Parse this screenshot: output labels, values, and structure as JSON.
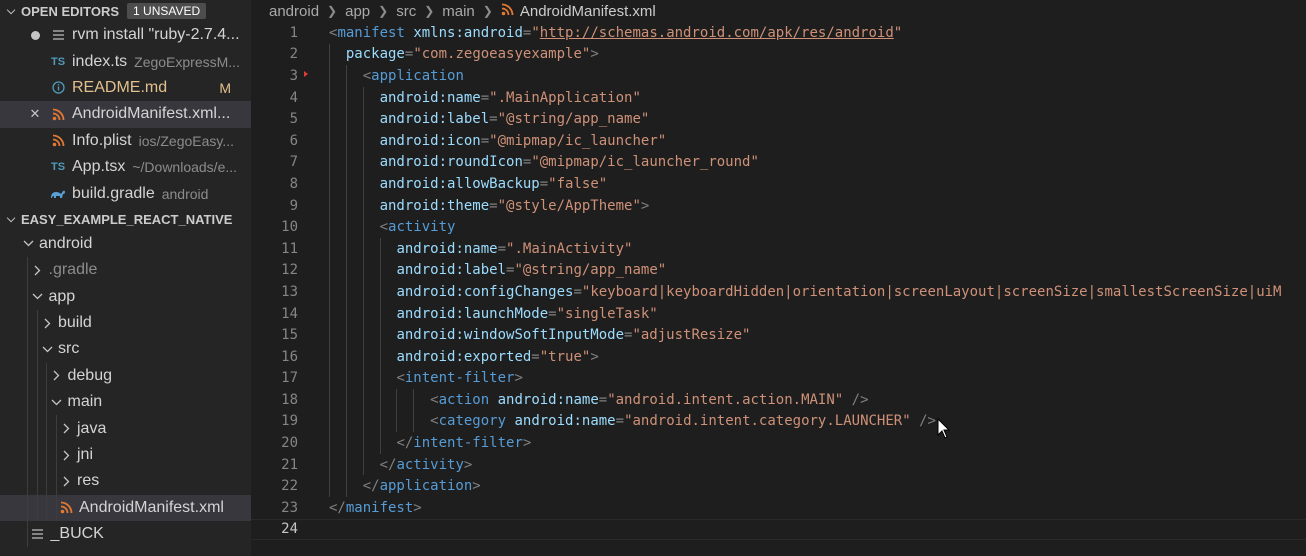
{
  "sidebar": {
    "open_editors": {
      "title": "OPEN EDITORS",
      "badge": "1 UNSAVED",
      "items": [
        {
          "lead": "dot",
          "icon": "terminal-icon",
          "name": "rvm install \"ruby-2.7.4...",
          "desc": "",
          "mark": ""
        },
        {
          "lead": "",
          "icon": "typescript-icon",
          "name": "index.ts",
          "desc": "ZegoExpressM...",
          "mark": ""
        },
        {
          "lead": "",
          "icon": "info-icon",
          "name": "README.md",
          "desc": "",
          "mark": "M"
        },
        {
          "lead": "close",
          "icon": "rss-icon",
          "name": "AndroidManifest.xml...",
          "desc": "",
          "mark": ""
        },
        {
          "lead": "",
          "icon": "rss-icon",
          "name": "Info.plist",
          "desc": "ios/ZegoEasy...",
          "mark": ""
        },
        {
          "lead": "",
          "icon": "typescript-icon",
          "name": "App.tsx",
          "desc": "~/Downloads/e...",
          "mark": ""
        },
        {
          "lead": "",
          "icon": "gradle-icon",
          "name": "build.gradle",
          "desc": "android",
          "mark": ""
        }
      ]
    },
    "project": {
      "title": "EASY_EXAMPLE_REACT_NATIVE",
      "tree": [
        {
          "label": "android",
          "depth": 0,
          "kind": "folder-open"
        },
        {
          "label": ".gradle",
          "depth": 1,
          "kind": "folder-closed"
        },
        {
          "label": "app",
          "depth": 1,
          "kind": "folder-open"
        },
        {
          "label": "build",
          "depth": 2,
          "kind": "folder-closed"
        },
        {
          "label": "src",
          "depth": 2,
          "kind": "folder-open"
        },
        {
          "label": "debug",
          "depth": 3,
          "kind": "folder-closed"
        },
        {
          "label": "main",
          "depth": 3,
          "kind": "folder-open"
        },
        {
          "label": "java",
          "depth": 4,
          "kind": "folder-closed"
        },
        {
          "label": "jni",
          "depth": 4,
          "kind": "folder-closed"
        },
        {
          "label": "res",
          "depth": 4,
          "kind": "folder-closed"
        },
        {
          "label": "AndroidManifest.xml",
          "depth": 4,
          "kind": "file-rss"
        },
        {
          "label": "_BUCK",
          "depth": 1,
          "kind": "file-lines"
        }
      ]
    }
  },
  "editor": {
    "breadcrumb": [
      "android",
      "app",
      "src",
      "main"
    ],
    "file": "AndroidManifest.xml",
    "current_line": 24,
    "lines": [
      [
        [
          "pun",
          "<"
        ],
        [
          "tag",
          "manifest"
        ],
        [
          "txt",
          " "
        ],
        [
          "attr",
          "xmlns:android"
        ],
        [
          "pun",
          "="
        ],
        [
          "str",
          "\""
        ],
        [
          "link",
          "http://schemas.android.com/apk/res/android"
        ],
        [
          "str",
          "\""
        ]
      ],
      [
        [
          "txt",
          "  "
        ],
        [
          "attr",
          "package"
        ],
        [
          "pun",
          "="
        ],
        [
          "str",
          "\"com.zegoeasyexample\""
        ],
        [
          "pun",
          ">"
        ]
      ],
      [
        [
          "txt",
          "    "
        ],
        [
          "pun",
          "<"
        ],
        [
          "tag",
          "application"
        ]
      ],
      [
        [
          "txt",
          "      "
        ],
        [
          "attr",
          "android:name"
        ],
        [
          "pun",
          "="
        ],
        [
          "str",
          "\".MainApplication\""
        ]
      ],
      [
        [
          "txt",
          "      "
        ],
        [
          "attr",
          "android:label"
        ],
        [
          "pun",
          "="
        ],
        [
          "str",
          "\"@string/app_name\""
        ]
      ],
      [
        [
          "txt",
          "      "
        ],
        [
          "attr",
          "android:icon"
        ],
        [
          "pun",
          "="
        ],
        [
          "str",
          "\"@mipmap/ic_launcher\""
        ]
      ],
      [
        [
          "txt",
          "      "
        ],
        [
          "attr",
          "android:roundIcon"
        ],
        [
          "pun",
          "="
        ],
        [
          "str",
          "\"@mipmap/ic_launcher_round\""
        ]
      ],
      [
        [
          "txt",
          "      "
        ],
        [
          "attr",
          "android:allowBackup"
        ],
        [
          "pun",
          "="
        ],
        [
          "str",
          "\"false\""
        ]
      ],
      [
        [
          "txt",
          "      "
        ],
        [
          "attr",
          "android:theme"
        ],
        [
          "pun",
          "="
        ],
        [
          "str",
          "\"@style/AppTheme\""
        ],
        [
          "pun",
          ">"
        ]
      ],
      [
        [
          "txt",
          "      "
        ],
        [
          "pun",
          "<"
        ],
        [
          "tag",
          "activity"
        ]
      ],
      [
        [
          "txt",
          "        "
        ],
        [
          "attr",
          "android:name"
        ],
        [
          "pun",
          "="
        ],
        [
          "str",
          "\".MainActivity\""
        ]
      ],
      [
        [
          "txt",
          "        "
        ],
        [
          "attr",
          "android:label"
        ],
        [
          "pun",
          "="
        ],
        [
          "str",
          "\"@string/app_name\""
        ]
      ],
      [
        [
          "txt",
          "        "
        ],
        [
          "attr",
          "android:configChanges"
        ],
        [
          "pun",
          "="
        ],
        [
          "str",
          "\"keyboard|keyboardHidden|orientation|screenLayout|screenSize|smallestScreenSize|uiM"
        ]
      ],
      [
        [
          "txt",
          "        "
        ],
        [
          "attr",
          "android:launchMode"
        ],
        [
          "pun",
          "="
        ],
        [
          "str",
          "\"singleTask\""
        ]
      ],
      [
        [
          "txt",
          "        "
        ],
        [
          "attr",
          "android:windowSoftInputMode"
        ],
        [
          "pun",
          "="
        ],
        [
          "str",
          "\"adjustResize\""
        ]
      ],
      [
        [
          "txt",
          "        "
        ],
        [
          "attr",
          "android:exported"
        ],
        [
          "pun",
          "="
        ],
        [
          "str",
          "\"true\""
        ],
        [
          "pun",
          ">"
        ]
      ],
      [
        [
          "txt",
          "        "
        ],
        [
          "pun",
          "<"
        ],
        [
          "tag",
          "intent-filter"
        ],
        [
          "pun",
          ">"
        ]
      ],
      [
        [
          "txt",
          "            "
        ],
        [
          "pun",
          "<"
        ],
        [
          "tag",
          "action"
        ],
        [
          "txt",
          " "
        ],
        [
          "attr",
          "android:name"
        ],
        [
          "pun",
          "="
        ],
        [
          "str",
          "\"android.intent.action.MAIN\""
        ],
        [
          "txt",
          " "
        ],
        [
          "pun",
          "/>"
        ]
      ],
      [
        [
          "txt",
          "            "
        ],
        [
          "pun",
          "<"
        ],
        [
          "tag",
          "category"
        ],
        [
          "txt",
          " "
        ],
        [
          "attr",
          "android:name"
        ],
        [
          "pun",
          "="
        ],
        [
          "str",
          "\"android.intent.category.LAUNCHER\""
        ],
        [
          "txt",
          " "
        ],
        [
          "pun",
          "/>"
        ]
      ],
      [
        [
          "txt",
          "        "
        ],
        [
          "pun",
          "</"
        ],
        [
          "tag",
          "intent-filter"
        ],
        [
          "pun",
          ">"
        ]
      ],
      [
        [
          "txt",
          "      "
        ],
        [
          "pun",
          "</"
        ],
        [
          "tag",
          "activity"
        ],
        [
          "pun",
          ">"
        ]
      ],
      [
        [
          "txt",
          "    "
        ],
        [
          "pun",
          "</"
        ],
        [
          "tag",
          "application"
        ],
        [
          "pun",
          ">"
        ]
      ],
      [
        [
          "pun",
          "</"
        ],
        [
          "tag",
          "manifest"
        ],
        [
          "pun",
          ">"
        ]
      ],
      []
    ]
  },
  "colors": {
    "sidebar_bg": "#252526",
    "editor_bg": "#1e1e1e",
    "tag": "#569cd6",
    "attr": "#9cdcfe",
    "string": "#ce9178",
    "modified": "#e2c08d",
    "ts_icon": "#519aba",
    "rss_icon": "#e37933"
  }
}
